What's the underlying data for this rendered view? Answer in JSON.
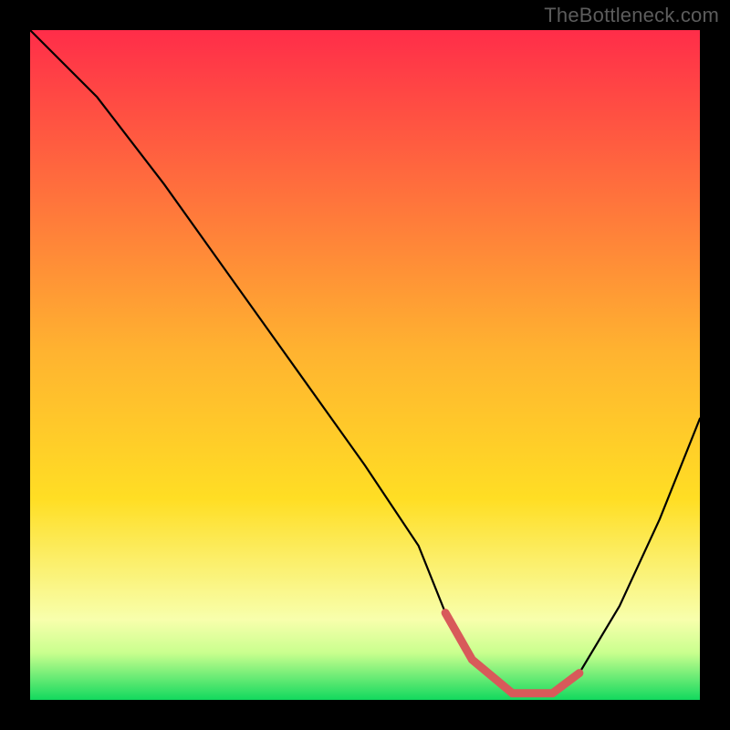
{
  "watermark": "TheBottleneck.com",
  "chart_data": {
    "type": "line",
    "title": "",
    "xlabel": "",
    "ylabel": "",
    "xlim": [
      0,
      100
    ],
    "ylim": [
      0,
      100
    ],
    "background_gradient": {
      "top": "#ff2d49",
      "middle": "#ffde24",
      "bottom_band_top": "#f8ffac",
      "bottom": "#12d95e"
    },
    "series": [
      {
        "name": "curve",
        "color": "#000000",
        "x": [
          0,
          4,
          10,
          20,
          30,
          40,
          50,
          58,
          62,
          66,
          72,
          78,
          82,
          88,
          94,
          100
        ],
        "y": [
          100,
          96,
          90,
          77,
          63,
          49,
          35,
          23,
          13,
          6,
          1,
          1,
          4,
          14,
          27,
          42
        ]
      },
      {
        "name": "min-highlight",
        "color": "#d85a5a",
        "x": [
          62,
          66,
          72,
          78,
          82
        ],
        "y": [
          13,
          6,
          1,
          1,
          4
        ]
      }
    ],
    "min_region": {
      "x_start": 62,
      "x_end": 82,
      "y": 1
    }
  }
}
